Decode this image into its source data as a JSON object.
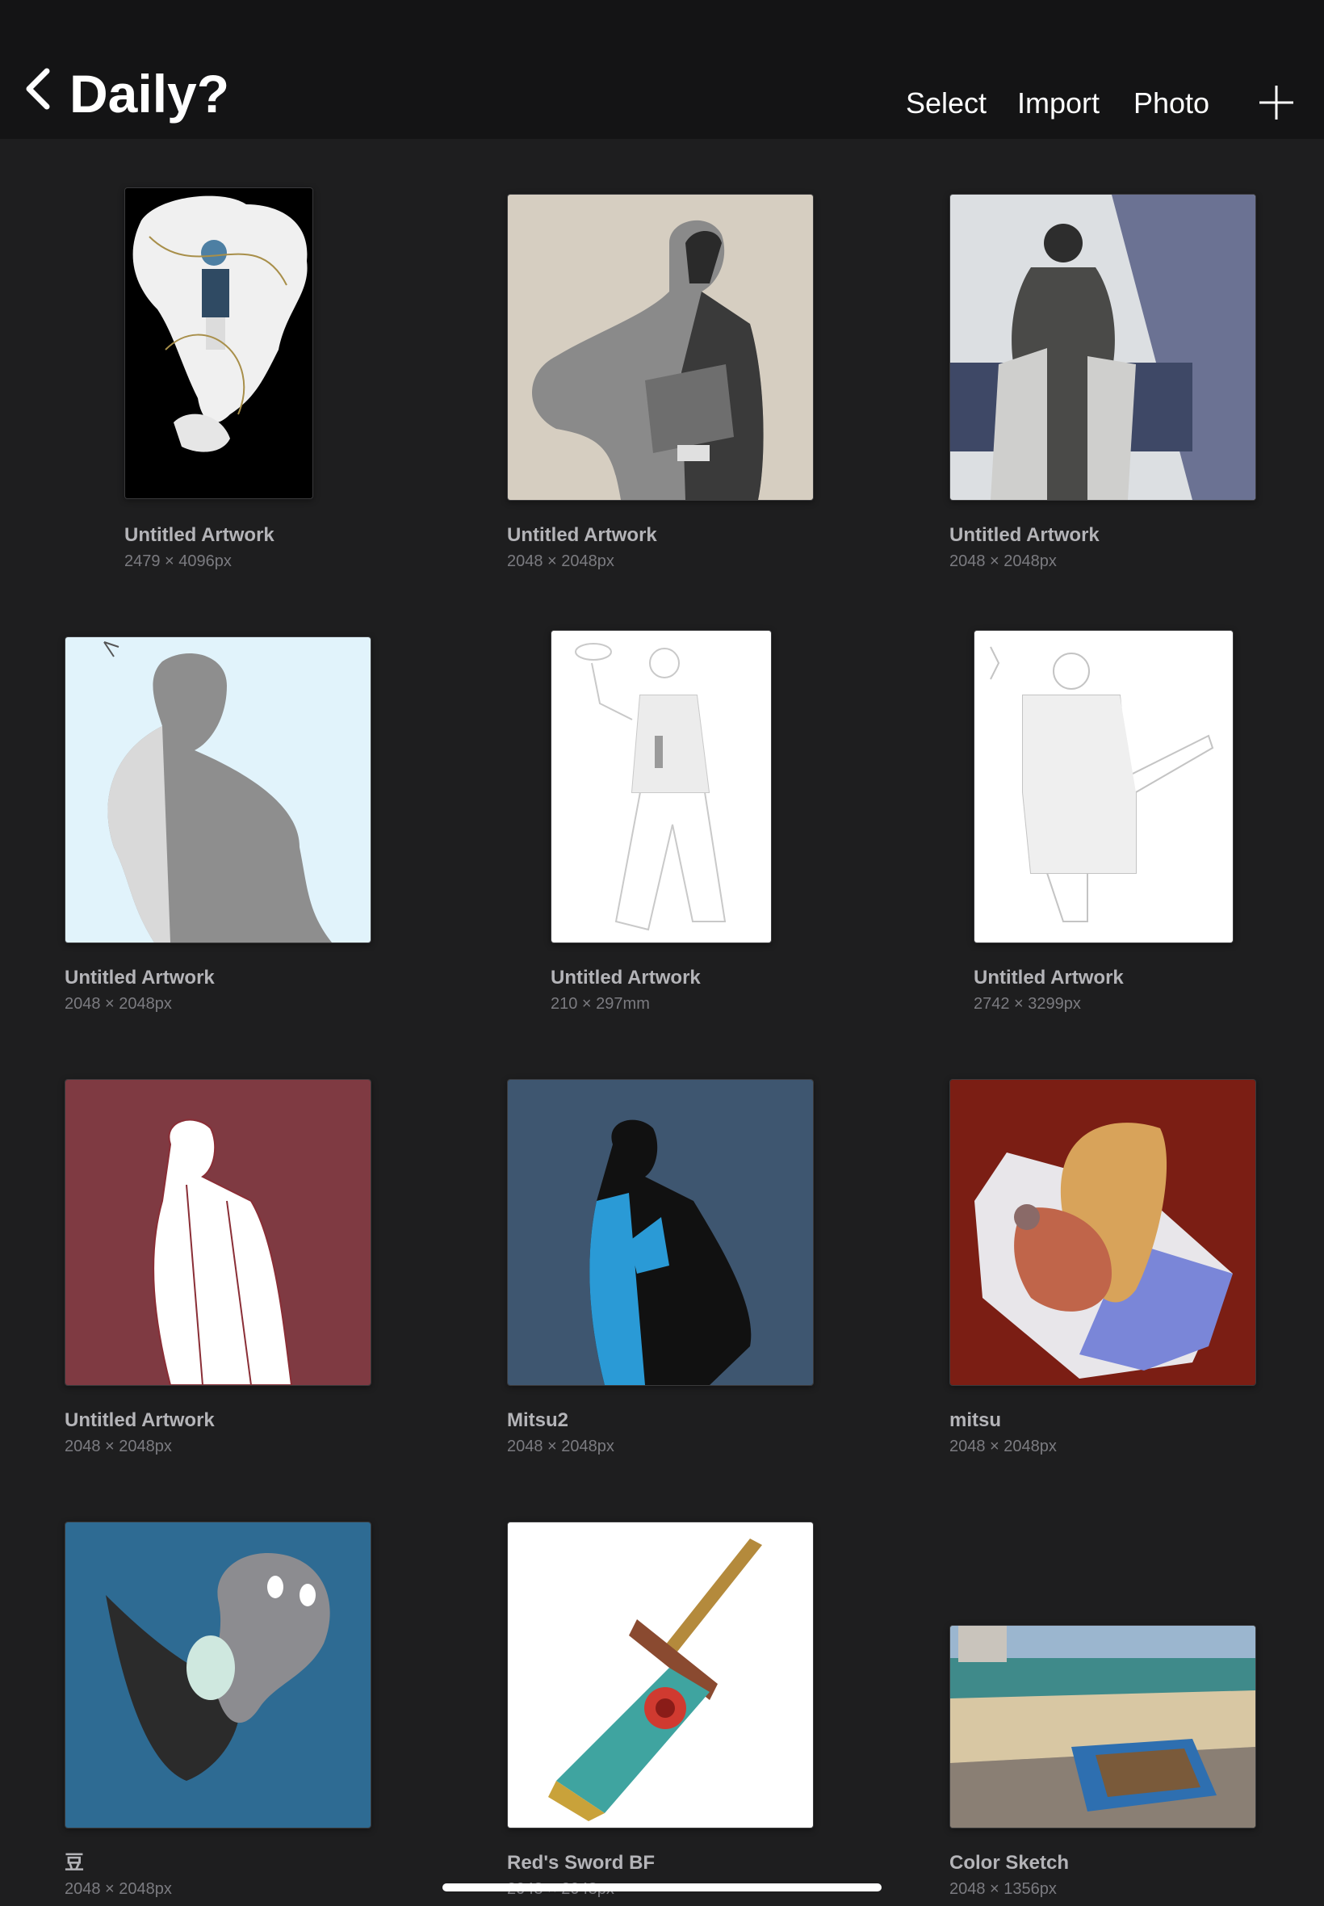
{
  "header": {
    "title": "Daily?",
    "back_icon": "chevron-left-icon",
    "actions": {
      "select": "Select",
      "import": "Import",
      "photo": "Photo"
    },
    "add_icon": "plus-icon"
  },
  "gallery": {
    "items": [
      {
        "name": "Untitled Artwork",
        "size": "2479 × 4096px",
        "bg": "#000000"
      },
      {
        "name": "Untitled Artwork",
        "size": "2048 × 2048px",
        "bg": "#d6cec1"
      },
      {
        "name": "Untitled Artwork",
        "size": "2048 × 2048px",
        "bg": "#dcdfe2"
      },
      {
        "name": "Untitled Artwork",
        "size": "2048 × 2048px",
        "bg": "#e1f3fb"
      },
      {
        "name": "Untitled Artwork",
        "size": "210 × 297mm",
        "bg": "#ffffff"
      },
      {
        "name": "Untitled Artwork",
        "size": "2742 × 3299px",
        "bg": "#ffffff"
      },
      {
        "name": "Untitled Artwork",
        "size": "2048 × 2048px",
        "bg": "#7f3a42"
      },
      {
        "name": "Mitsu2",
        "size": "2048 × 2048px",
        "bg": "#3e5670"
      },
      {
        "name": "mitsu",
        "size": "2048 × 2048px",
        "bg": "#7b1e14"
      },
      {
        "name": "豆",
        "size": "2048 × 2048px",
        "bg": "#2e6b93"
      },
      {
        "name": "Red's Sword BF",
        "size": "2048 × 2048px",
        "bg": "#ffffff"
      },
      {
        "name": "Color Sketch",
        "size": "2048 × 1356px",
        "bg": "#b8a98f"
      }
    ]
  }
}
